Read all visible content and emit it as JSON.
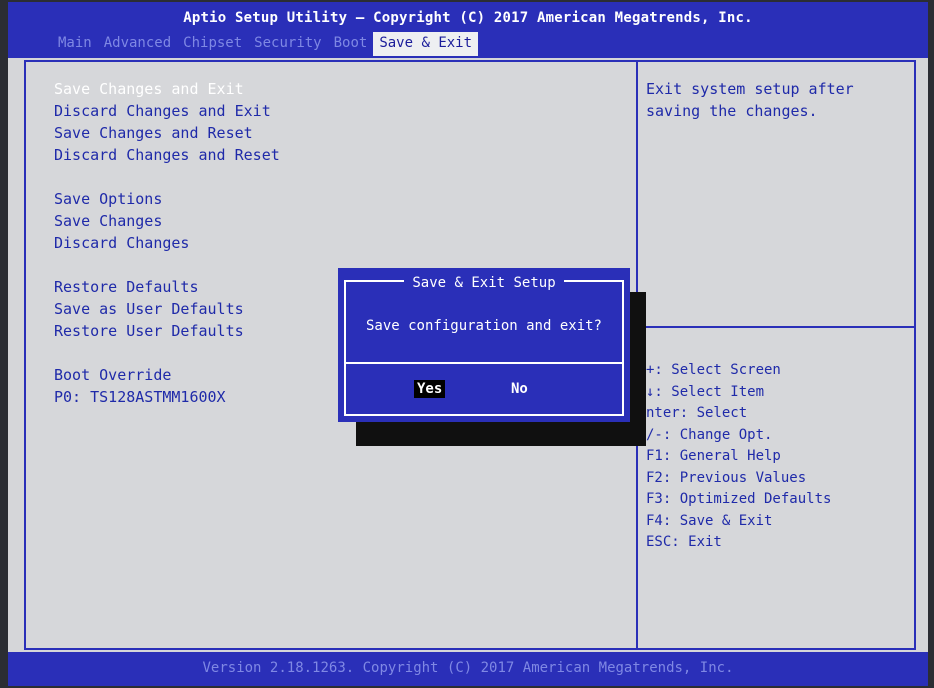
{
  "header": {
    "title": "Aptio Setup Utility – Copyright (C) 2017 American Megatrends, Inc.",
    "tabs": [
      {
        "label": "Main"
      },
      {
        "label": "Advanced"
      },
      {
        "label": "Chipset"
      },
      {
        "label": "Security"
      },
      {
        "label": "Boot"
      },
      {
        "label": "Save & Exit"
      }
    ],
    "active_tab": "Save & Exit"
  },
  "menu": {
    "group1": [
      "Save Changes and Exit",
      "Discard Changes and Exit",
      "Save Changes and Reset",
      "Discard Changes and Reset"
    ],
    "group2": [
      "Save Options",
      "Save Changes",
      "Discard Changes"
    ],
    "group3": [
      "Restore Defaults",
      "Save as User Defaults",
      "Restore User Defaults"
    ],
    "group4": [
      "Boot Override",
      "P0: TS128ASTMM1600X"
    ],
    "selected": "Save Changes and Exit"
  },
  "help": {
    "text": "Exit system setup after saving the changes."
  },
  "keys": [
    "+: Select Screen",
    "↓: Select Item",
    "nter: Select",
    "/-: Change Opt.",
    "F1: General Help",
    "F2: Previous Values",
    "F3: Optimized Defaults",
    "F4: Save & Exit",
    "ESC: Exit"
  ],
  "dialog": {
    "title": "Save & Exit Setup",
    "message": "Save configuration and exit?",
    "yes_label": "Yes",
    "no_label": "No",
    "selected": "Yes"
  },
  "footer": {
    "version": "Version 2.18.1263. Copyright (C) 2017 American Megatrends, Inc."
  },
  "colors": {
    "bios_blue": "#2a2fb8",
    "panel_gray": "#d6d7da",
    "menu_text": "#1f2aa9",
    "inactive_tab": "#7f88e4"
  }
}
